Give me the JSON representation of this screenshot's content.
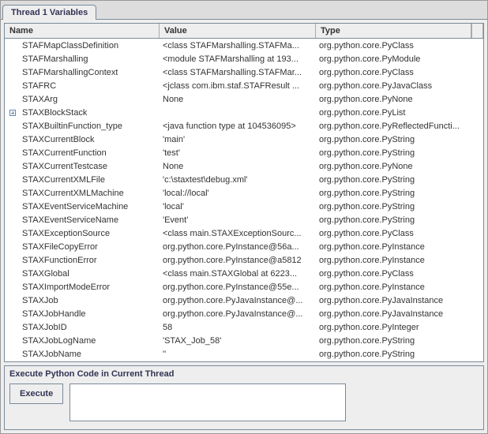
{
  "tab": {
    "label": "Thread 1 Variables"
  },
  "columns": {
    "name": "Name",
    "value": "Value",
    "type": "Type"
  },
  "rows": [
    {
      "name": "STAFMapClassDefinition",
      "value": "<class STAFMarshalling.STAFMa...",
      "type": "org.python.core.PyClass",
      "expandable": false
    },
    {
      "name": "STAFMarshalling",
      "value": "<module STAFMarshalling at 193...",
      "type": "org.python.core.PyModule",
      "expandable": false
    },
    {
      "name": "STAFMarshallingContext",
      "value": "<class STAFMarshalling.STAFMar...",
      "type": "org.python.core.PyClass",
      "expandable": false
    },
    {
      "name": "STAFRC",
      "value": "<jclass com.ibm.staf.STAFResult ...",
      "type": "org.python.core.PyJavaClass",
      "expandable": false
    },
    {
      "name": "STAXArg",
      "value": "None",
      "type": "org.python.core.PyNone",
      "expandable": false
    },
    {
      "name": "STAXBlockStack",
      "value": "",
      "type": "org.python.core.PyList",
      "expandable": true
    },
    {
      "name": "STAXBuiltinFunction_type",
      "value": "<java function type at 104536095>",
      "type": "org.python.core.PyReflectedFuncti...",
      "expandable": false
    },
    {
      "name": "STAXCurrentBlock",
      "value": "'main'",
      "type": "org.python.core.PyString",
      "expandable": false
    },
    {
      "name": "STAXCurrentFunction",
      "value": "'test'",
      "type": "org.python.core.PyString",
      "expandable": false
    },
    {
      "name": "STAXCurrentTestcase",
      "value": "None",
      "type": "org.python.core.PyNone",
      "expandable": false
    },
    {
      "name": "STAXCurrentXMLFile",
      "value": "'c:\\staxtest\\debug.xml'",
      "type": "org.python.core.PyString",
      "expandable": false
    },
    {
      "name": "STAXCurrentXMLMachine",
      "value": "'local://local'",
      "type": "org.python.core.PyString",
      "expandable": false
    },
    {
      "name": "STAXEventServiceMachine",
      "value": "'local'",
      "type": "org.python.core.PyString",
      "expandable": false
    },
    {
      "name": "STAXEventServiceName",
      "value": "'Event'",
      "type": "org.python.core.PyString",
      "expandable": false
    },
    {
      "name": "STAXExceptionSource",
      "value": "<class main.STAXExceptionSourc...",
      "type": "org.python.core.PyClass",
      "expandable": false
    },
    {
      "name": "STAXFileCopyError",
      "value": "org.python.core.PyInstance@56a...",
      "type": "org.python.core.PyInstance",
      "expandable": false
    },
    {
      "name": "STAXFunctionError",
      "value": "org.python.core.PyInstance@a5812",
      "type": "org.python.core.PyInstance",
      "expandable": false
    },
    {
      "name": "STAXGlobal",
      "value": "<class main.STAXGlobal at 6223...",
      "type": "org.python.core.PyClass",
      "expandable": false
    },
    {
      "name": "STAXImportModeError",
      "value": "org.python.core.PyInstance@55e...",
      "type": "org.python.core.PyInstance",
      "expandable": false
    },
    {
      "name": "STAXJob",
      "value": "org.python.core.PyJavaInstance@...",
      "type": "org.python.core.PyJavaInstance",
      "expandable": false
    },
    {
      "name": "STAXJobHandle",
      "value": "org.python.core.PyJavaInstance@...",
      "type": "org.python.core.PyJavaInstance",
      "expandable": false
    },
    {
      "name": "STAXJobID",
      "value": "58",
      "type": "org.python.core.PyInteger",
      "expandable": false
    },
    {
      "name": "STAXJobLogName",
      "value": "'STAX_Job_58'",
      "type": "org.python.core.PyString",
      "expandable": false
    },
    {
      "name": "STAXJobName",
      "value": "''",
      "type": "org.python.core.PyString",
      "expandable": false
    }
  ],
  "bottom": {
    "title": "Execute Python Code in Current Thread",
    "execute_label": "Execute",
    "textarea_value": ""
  }
}
